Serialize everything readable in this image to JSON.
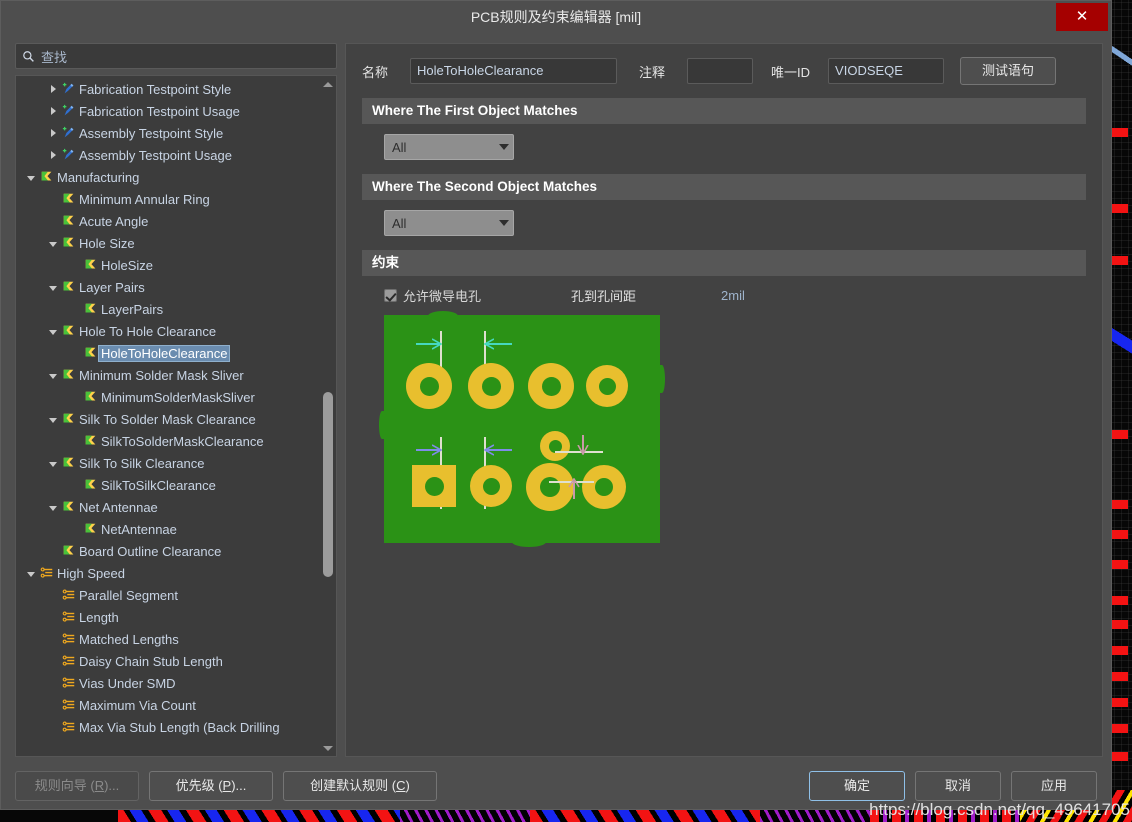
{
  "window": {
    "title": "PCB规则及约束编辑器 [mil]",
    "close_label": "✕"
  },
  "search": {
    "placeholder": "查找",
    "value": "",
    "icon": "search-icon"
  },
  "tree": {
    "items": [
      {
        "label": "Fabrication Testpoint Style",
        "depth": 2,
        "arrow": "collapsed",
        "icon": "testpoint-icon",
        "selected": false
      },
      {
        "label": "Fabrication Testpoint Usage",
        "depth": 2,
        "arrow": "collapsed",
        "icon": "testpoint-icon",
        "selected": false
      },
      {
        "label": "Assembly Testpoint Style",
        "depth": 2,
        "arrow": "collapsed",
        "icon": "testpoint-icon",
        "selected": false
      },
      {
        "label": "Assembly Testpoint Usage",
        "depth": 2,
        "arrow": "collapsed",
        "icon": "testpoint-icon",
        "selected": false
      },
      {
        "label": "Manufacturing",
        "depth": 1,
        "arrow": "expanded",
        "icon": "flag-icon",
        "selected": false
      },
      {
        "label": "Minimum Annular Ring",
        "depth": 2,
        "arrow": "none",
        "icon": "flag-icon",
        "selected": false
      },
      {
        "label": "Acute Angle",
        "depth": 2,
        "arrow": "none",
        "icon": "flag-icon",
        "selected": false
      },
      {
        "label": "Hole Size",
        "depth": 2,
        "arrow": "expanded",
        "icon": "flag-icon",
        "selected": false
      },
      {
        "label": "HoleSize",
        "depth": 3,
        "arrow": "none",
        "icon": "flag-icon",
        "selected": false
      },
      {
        "label": "Layer Pairs",
        "depth": 2,
        "arrow": "expanded",
        "icon": "flag-icon",
        "selected": false
      },
      {
        "label": "LayerPairs",
        "depth": 3,
        "arrow": "none",
        "icon": "flag-icon",
        "selected": false
      },
      {
        "label": "Hole To Hole Clearance",
        "depth": 2,
        "arrow": "expanded",
        "icon": "flag-icon",
        "selected": false
      },
      {
        "label": "HoleToHoleClearance",
        "depth": 3,
        "arrow": "none",
        "icon": "flag-icon",
        "selected": true
      },
      {
        "label": "Minimum Solder Mask Sliver",
        "depth": 2,
        "arrow": "expanded",
        "icon": "flag-icon",
        "selected": false
      },
      {
        "label": "MinimumSolderMaskSliver",
        "depth": 3,
        "arrow": "none",
        "icon": "flag-icon",
        "selected": false
      },
      {
        "label": "Silk To Solder Mask Clearance",
        "depth": 2,
        "arrow": "expanded",
        "icon": "flag-icon",
        "selected": false
      },
      {
        "label": "SilkToSolderMaskClearance",
        "depth": 3,
        "arrow": "none",
        "icon": "flag-icon",
        "selected": false
      },
      {
        "label": "Silk To Silk Clearance",
        "depth": 2,
        "arrow": "expanded",
        "icon": "flag-icon",
        "selected": false
      },
      {
        "label": "SilkToSilkClearance",
        "depth": 3,
        "arrow": "none",
        "icon": "flag-icon",
        "selected": false
      },
      {
        "label": "Net Antennae",
        "depth": 2,
        "arrow": "expanded",
        "icon": "flag-icon",
        "selected": false
      },
      {
        "label": "NetAntennae",
        "depth": 3,
        "arrow": "none",
        "icon": "flag-icon",
        "selected": false
      },
      {
        "label": "Board Outline Clearance",
        "depth": 2,
        "arrow": "none",
        "icon": "flag-icon",
        "selected": false
      },
      {
        "label": "High Speed",
        "depth": 1,
        "arrow": "expanded",
        "icon": "highspeed-icon",
        "selected": false
      },
      {
        "label": "Parallel Segment",
        "depth": 2,
        "arrow": "none",
        "icon": "highspeed-icon",
        "selected": false
      },
      {
        "label": "Length",
        "depth": 2,
        "arrow": "none",
        "icon": "highspeed-icon",
        "selected": false
      },
      {
        "label": "Matched Lengths",
        "depth": 2,
        "arrow": "none",
        "icon": "highspeed-icon",
        "selected": false
      },
      {
        "label": "Daisy Chain Stub Length",
        "depth": 2,
        "arrow": "none",
        "icon": "highspeed-icon",
        "selected": false
      },
      {
        "label": "Vias Under SMD",
        "depth": 2,
        "arrow": "none",
        "icon": "highspeed-icon",
        "selected": false
      },
      {
        "label": "Maximum Via Count",
        "depth": 2,
        "arrow": "none",
        "icon": "highspeed-icon",
        "selected": false
      },
      {
        "label": "Max Via Stub Length (Back Drilling",
        "depth": 2,
        "arrow": "none",
        "icon": "highspeed-icon",
        "selected": false
      }
    ]
  },
  "rule": {
    "name_label": "名称",
    "name_value": "HoleToHoleClearance",
    "comment_label": "注释",
    "comment_value": "",
    "uid_label": "唯一ID",
    "uid_value": "VIODSEQE",
    "test_query_button": "测试语句"
  },
  "first_match": {
    "header": "Where The First Object Matches",
    "selected": "All"
  },
  "second_match": {
    "header": "Where The Second Object Matches",
    "selected": "All"
  },
  "constraint": {
    "header": "约束",
    "checkbox_label": "允许微导电孔",
    "checkbox_checked": true,
    "gap_label": "孔到孔间距",
    "gap_value": "2mil"
  },
  "footer": {
    "rule_wizard": "规则向导 (R)...",
    "priority": "优先级 (P)...",
    "create_default": "创建默认规则 (C)",
    "ok": "确定",
    "cancel": "取消",
    "apply": "应用"
  },
  "watermark": {
    "text": "https://blog.csdn.net/qq_49641705"
  },
  "colors": {
    "accent_select": "#6a8caf",
    "close_red": "#a50000",
    "pcb_green": "#2b9216",
    "pad_gold": "#e8bf2e",
    "value_blue": "#9fb4cc",
    "primary_border": "#8fc0e8"
  }
}
